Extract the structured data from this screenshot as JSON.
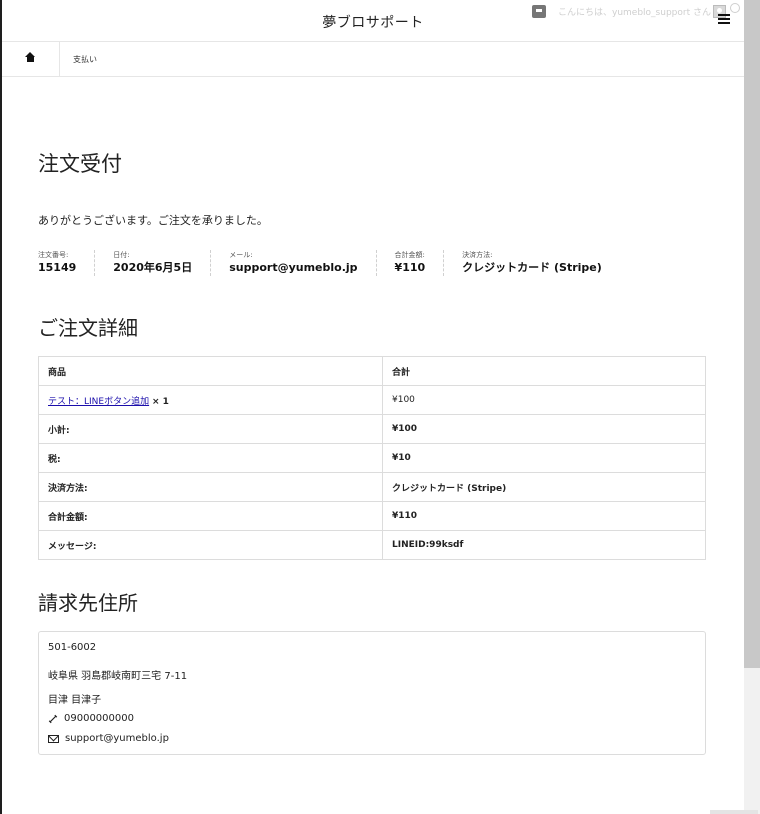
{
  "header": {
    "site_title": "夢ブロサポート",
    "admin_greeting": "こんにちは、yumeblo_support さん"
  },
  "breadcrumb": {
    "current": "支払い"
  },
  "main": {
    "title": "注文受付",
    "thanks_message": "ありがとうございます。ご注文を承りました。",
    "overview": [
      {
        "label": "注文番号:",
        "value": "15149"
      },
      {
        "label": "日付:",
        "value": "2020年6月5日"
      },
      {
        "label": "メール:",
        "value": "support@yumeblo.jp"
      },
      {
        "label": "合計金額:",
        "value": "¥110"
      },
      {
        "label": "決済方法:",
        "value": "クレジットカード (Stripe)"
      }
    ],
    "details_title": "ご注文詳細",
    "details_table": {
      "header": {
        "product": "商品",
        "total": "合計"
      },
      "item": {
        "name": "テスト：LINEボタン追加",
        "qty": "× 1",
        "total": "¥100"
      },
      "rows": [
        {
          "label": "小計:",
          "value": "¥100"
        },
        {
          "label": "税:",
          "value": "¥10"
        },
        {
          "label": "決済方法:",
          "value": "クレジットカード (Stripe)"
        },
        {
          "label": "合計金額:",
          "value": "¥110"
        },
        {
          "label": "メッセージ:",
          "value": "LINEID:99ksdf"
        }
      ]
    },
    "billing_title": "請求先住所",
    "billing": {
      "postcode": "501-6002",
      "address": "岐阜県 羽島郡岐南町三宅 7-11",
      "name": "目津 目津子",
      "phone": "09000000000",
      "email": "support@yumeblo.jp"
    }
  },
  "icons": {
    "home": "home-icon",
    "menu": "hamburger-menu-icon",
    "comment": "comment-icon",
    "phone": "phone-icon",
    "email": "email-icon"
  }
}
